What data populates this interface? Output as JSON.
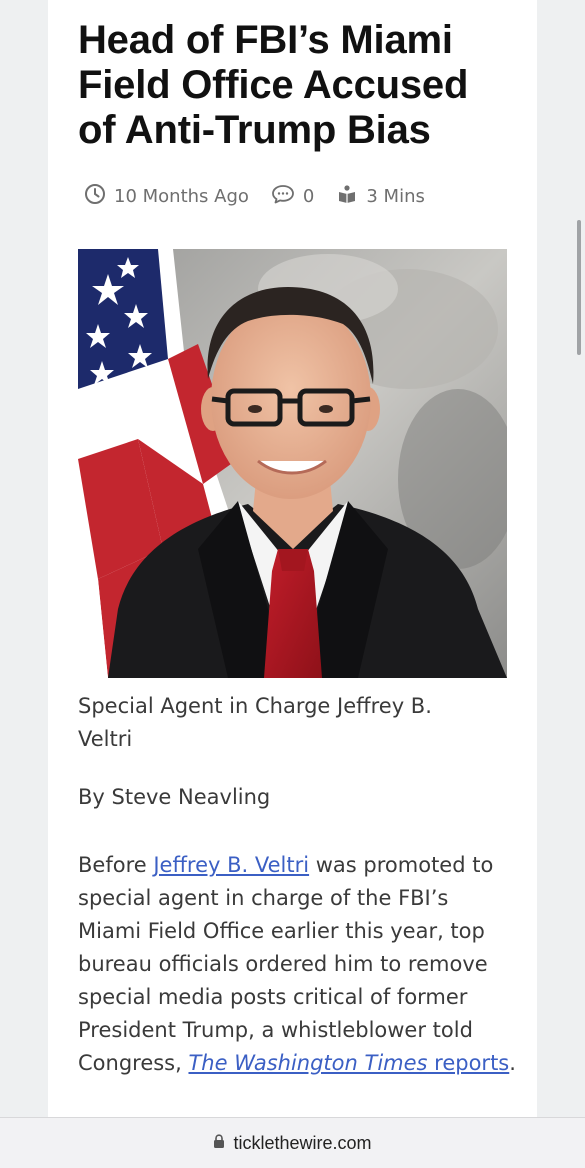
{
  "article": {
    "headline_lines": [
      "Head of FBI’s Miami",
      "Field Office Accused",
      "of Anti-Trump Bias"
    ],
    "meta": {
      "time_label": "10 Months Ago",
      "comments_count": "0",
      "read_time": "3 Mins"
    },
    "image": {
      "icon": "portrait-photo"
    },
    "caption_lines": [
      "Special Agent in Charge Jeffrey B.",
      "Veltri"
    ],
    "byline": "By Steve Neavling",
    "body": {
      "p1_before": "Before ",
      "p1_link1": "Jeffrey B. Veltri",
      "p1_mid1": " was promoted to special agent in charge of the FBI’s Miami Field Office earlier this year, top bureau officials ordered him to remove special media posts critical of former President Trump, a whistleblower told Congress, ",
      "p1_link2_italic": "The Washington Times",
      "p1_link2_rest": " reports",
      "p1_end": "."
    }
  },
  "browser": {
    "url": "ticklethewire.com",
    "lock_icon": "lock-icon"
  }
}
